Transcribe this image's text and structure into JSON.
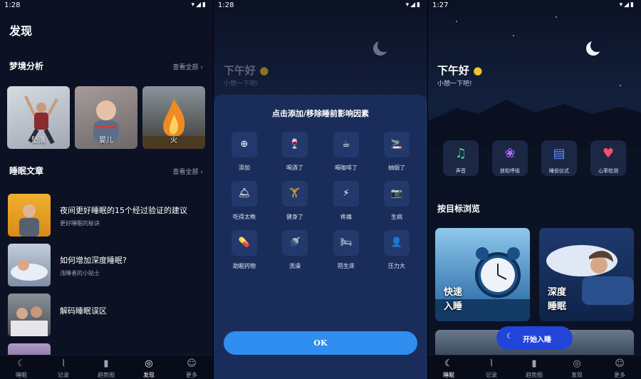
{
  "panel1": {
    "status_time": "1:28",
    "title": "发现",
    "dream_section": {
      "title": "梦境分析",
      "see_all": "查看全部"
    },
    "dream_cards": [
      {
        "label": "坠落"
      },
      {
        "label": "婴儿"
      },
      {
        "label": "火"
      }
    ],
    "article_section": {
      "title": "睡眠文章",
      "see_all": "查看全部"
    },
    "articles": [
      {
        "title": "夜间更好睡眠的15个经过验证的建议",
        "subtitle": "更好睡眠的秘诀"
      },
      {
        "title": "如何增加深度睡眠?",
        "subtitle": "浅睡者的小贴士"
      },
      {
        "title": "解码睡眠误区",
        "subtitle": ""
      }
    ],
    "nav": [
      {
        "label": "睡眠",
        "icon": "moon-icon"
      },
      {
        "label": "记录",
        "icon": "chart-icon"
      },
      {
        "label": "趋势图",
        "icon": "bars-icon"
      },
      {
        "label": "发现",
        "icon": "planet-icon"
      },
      {
        "label": "更多",
        "icon": "smile-icon"
      }
    ]
  },
  "panel2": {
    "status_time": "1:28",
    "greeting": "下午好",
    "greeting_sub": "小憩一下吧!",
    "sheet_title": "点击添加/移除睡前影响因素",
    "factors": [
      {
        "label": "添加",
        "glyph": "⊕"
      },
      {
        "label": "喝酒了",
        "glyph": "🍷"
      },
      {
        "label": "喝咖啡了",
        "glyph": "☕"
      },
      {
        "label": "抽烟了",
        "glyph": "🚬"
      },
      {
        "label": "吃得太晚",
        "glyph": "🛎"
      },
      {
        "label": "健身了",
        "glyph": "🏋"
      },
      {
        "label": "疼痛",
        "glyph": "⚡"
      },
      {
        "label": "生病",
        "glyph": "📷"
      },
      {
        "label": "助眠药物",
        "glyph": "💊"
      },
      {
        "label": "洗澡",
        "glyph": "🚿"
      },
      {
        "label": "陌生床",
        "glyph": "🛏"
      },
      {
        "label": "压力大",
        "glyph": "👤"
      }
    ],
    "ok_label": "OK"
  },
  "panel3": {
    "status_time": "1:27",
    "greeting": "下午好",
    "greeting_sub": "小憩一下吧!",
    "tools": [
      {
        "label": "声音",
        "glyph": "♫",
        "color": "#39d98a"
      },
      {
        "label": "放松呼吸",
        "glyph": "❀",
        "color": "#b06cff"
      },
      {
        "label": "睡前仪式",
        "glyph": "▤",
        "color": "#5b8cff"
      },
      {
        "label": "心率检测",
        "glyph": "♥",
        "color": "#ff4d6a"
      }
    ],
    "browse_title": "按目标浏览",
    "goals": [
      {
        "label": "快速\n入睡"
      },
      {
        "label": "深度\n睡眠"
      }
    ],
    "start_sleep": "开始入睡",
    "nav": [
      {
        "label": "睡眠"
      },
      {
        "label": "记录"
      },
      {
        "label": "趋势图"
      },
      {
        "label": "发现"
      },
      {
        "label": "更多"
      }
    ]
  }
}
